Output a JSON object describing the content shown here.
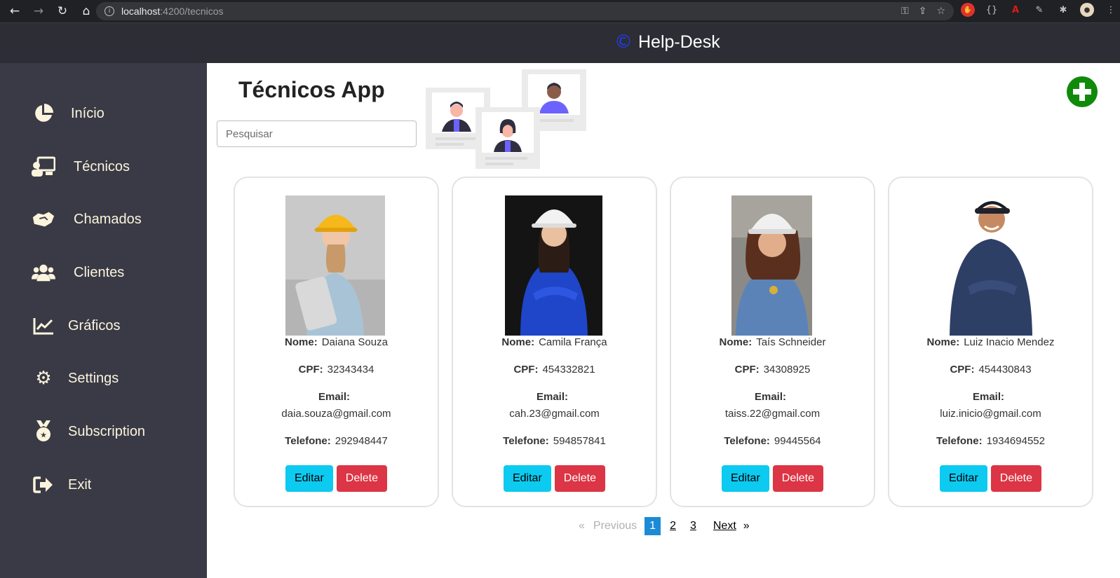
{
  "browser": {
    "url_host": "localhost",
    "url_path": ":4200/tecnicos"
  },
  "header": {
    "brand_symbol": "©",
    "brand_title": "Help-Desk"
  },
  "sidebar": {
    "items": [
      {
        "label": "Início",
        "icon": "pie-chart-icon"
      },
      {
        "label": "Técnicos",
        "icon": "technician-icon"
      },
      {
        "label": "Chamados",
        "icon": "handshake-icon"
      },
      {
        "label": "Clientes",
        "icon": "users-icon"
      },
      {
        "label": "Gráficos",
        "icon": "line-chart-icon"
      },
      {
        "label": "Settings",
        "icon": "gear-icon"
      },
      {
        "label": "Subscription",
        "icon": "medal-icon"
      },
      {
        "label": "Exit",
        "icon": "exit-icon"
      }
    ]
  },
  "main": {
    "title": "Técnicos App",
    "search_placeholder": "Pesquisar",
    "labels": {
      "nome": "Nome:",
      "cpf": "CPF:",
      "email": "Email:",
      "telefone": "Telefone:",
      "edit": "Editar",
      "delete": "Delete"
    },
    "tecnicos": [
      {
        "nome": "Daiana Souza",
        "cpf": "32343434",
        "email": "daia.souza@gmail.com",
        "telefone": "292948447"
      },
      {
        "nome": "Camila França",
        "cpf": "454332821",
        "email": "cah.23@gmail.com",
        "telefone": "594857841"
      },
      {
        "nome": "Taís Schneider",
        "cpf": "34308925",
        "email": "taiss.22@gmail.com",
        "telefone": "99445564"
      },
      {
        "nome": "Luiz Inacio Mendez",
        "cpf": "454430843",
        "email": "luiz.inicio@gmail.com",
        "telefone": "1934694552"
      }
    ],
    "pagination": {
      "prev_symbol": "«",
      "prev": "Previous",
      "pages": [
        "1",
        "2",
        "3"
      ],
      "current": "1",
      "next": "Next",
      "next_symbol": "»"
    }
  },
  "colors": {
    "accent_add": "#108a0a",
    "edit": "#0dcaf0",
    "delete": "#dc3545",
    "pager_active": "#1c8bd6"
  }
}
